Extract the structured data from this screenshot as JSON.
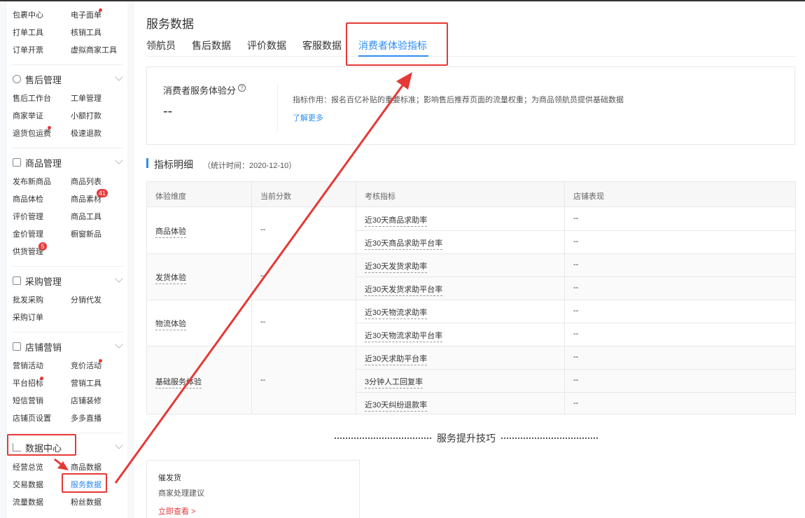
{
  "sidebar": {
    "top_links": [
      {
        "label": "包裹中心"
      },
      {
        "label": "电子面单"
      },
      {
        "label": "打单工具"
      },
      {
        "label": "核销工具"
      },
      {
        "label": "订单开票"
      },
      {
        "label": "虚拟商家工具"
      }
    ],
    "sections": [
      {
        "title": "售后管理",
        "items": [
          "售后工作台",
          "工单管理",
          "商家举证",
          "小额打款",
          "退货包运费",
          "极速退款"
        ]
      },
      {
        "title": "商品管理",
        "items": [
          "发布新商品",
          "商品列表",
          "商品体检",
          "商品素材",
          "评价管理",
          "商品工具",
          "金价管理",
          "橱窗新品",
          "供货管理"
        ]
      },
      {
        "title": "采购管理",
        "items": [
          "批发采购",
          "分销代发",
          "采购订单"
        ]
      },
      {
        "title": "店铺营销",
        "items": [
          "营销活动",
          "竞价活动",
          "平台招标",
          "营销工具",
          "短信营销",
          "店铺装修",
          "店铺页设置",
          "多多直播"
        ]
      },
      {
        "title": "数据中心",
        "items": [
          "经营总览",
          "商品数据",
          "交易数据",
          "服务数据",
          "流量数据",
          "粉丝数据"
        ]
      }
    ],
    "badges": {
      "material": "41",
      "supply": "5"
    }
  },
  "page": {
    "title": "服务数据",
    "tabs": [
      "领航员",
      "售后数据",
      "评价数据",
      "客服数据",
      "消费者体验指标"
    ],
    "active_tab": "消费者体验指标"
  },
  "score_card": {
    "label": "消费者服务体验分",
    "help_icon": "?",
    "value": "--",
    "description": "指标作用：报名百亿补贴的重要标准；影响售后推荐页面的流量权重；为商品领航员提供基础数据",
    "learn_more": "了解更多"
  },
  "section": {
    "title": "指标明细",
    "time": "（统计时间：2020-12-10）"
  },
  "table": {
    "headers": [
      "体验维度",
      "当前分数",
      "考核指标",
      "店铺表现"
    ],
    "groups": [
      {
        "dimension": "商品体验",
        "score": "--",
        "metrics": [
          {
            "name": "近30天商品求助率",
            "value": "--"
          },
          {
            "name": "近30天商品求助平台率",
            "value": "--"
          }
        ]
      },
      {
        "dimension": "发货体验",
        "score": "--",
        "metrics": [
          {
            "name": "近30天发货求助率",
            "value": "--"
          },
          {
            "name": "近30天发货求助平台率",
            "value": "--"
          }
        ]
      },
      {
        "dimension": "物流体验",
        "score": "--",
        "metrics": [
          {
            "name": "近30天物流求助率",
            "value": "--"
          },
          {
            "name": "近30天物流求助平台率",
            "value": "--"
          }
        ]
      },
      {
        "dimension": "基础服务体验",
        "score": "--",
        "metrics": [
          {
            "name": "近30天求助平台率",
            "value": "--"
          },
          {
            "name": "3分钟人工回复率",
            "value": "--"
          },
          {
            "name": "近30天纠纷退款率",
            "value": "--"
          }
        ]
      }
    ]
  },
  "tips": {
    "title": "服务提升技巧",
    "card_title": "催发货",
    "card_sub": "商家处理建议",
    "card_link": "立即查看 >"
  },
  "colors": {
    "accent": "#2d8cf0",
    "highlight": "#e53935",
    "badge": "#e4393c"
  }
}
